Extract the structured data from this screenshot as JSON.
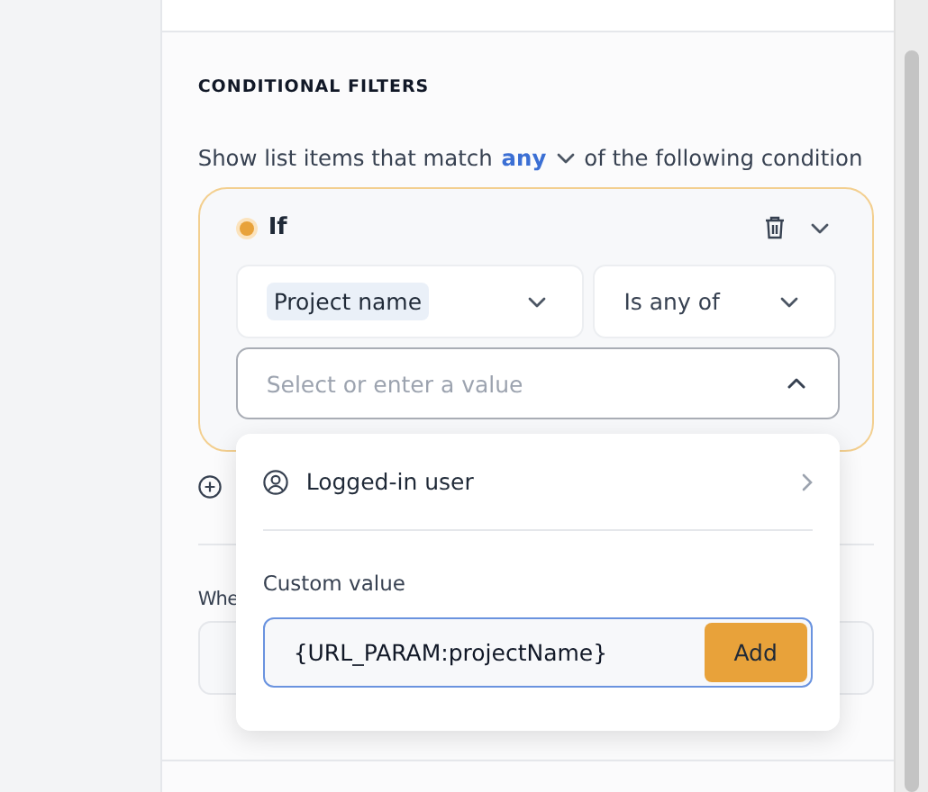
{
  "section_title": "CONDITIONAL FILTERS",
  "match_sentence": {
    "before": "Show list items that match",
    "mode": "any",
    "after": "of the following condition"
  },
  "condition": {
    "label": "If",
    "field": {
      "value": "Project name"
    },
    "operator": {
      "value": "Is any of"
    },
    "value_select": {
      "placeholder": "Select or enter a value",
      "expanded": true
    }
  },
  "next_section": {
    "label": "Whe"
  },
  "dropdown": {
    "items": [
      {
        "label": "Logged-in user",
        "has_submenu": true
      }
    ],
    "custom_label": "Custom value",
    "custom_input": {
      "value": "{URL_PARAM:projectName}"
    },
    "add_button": "Add"
  }
}
